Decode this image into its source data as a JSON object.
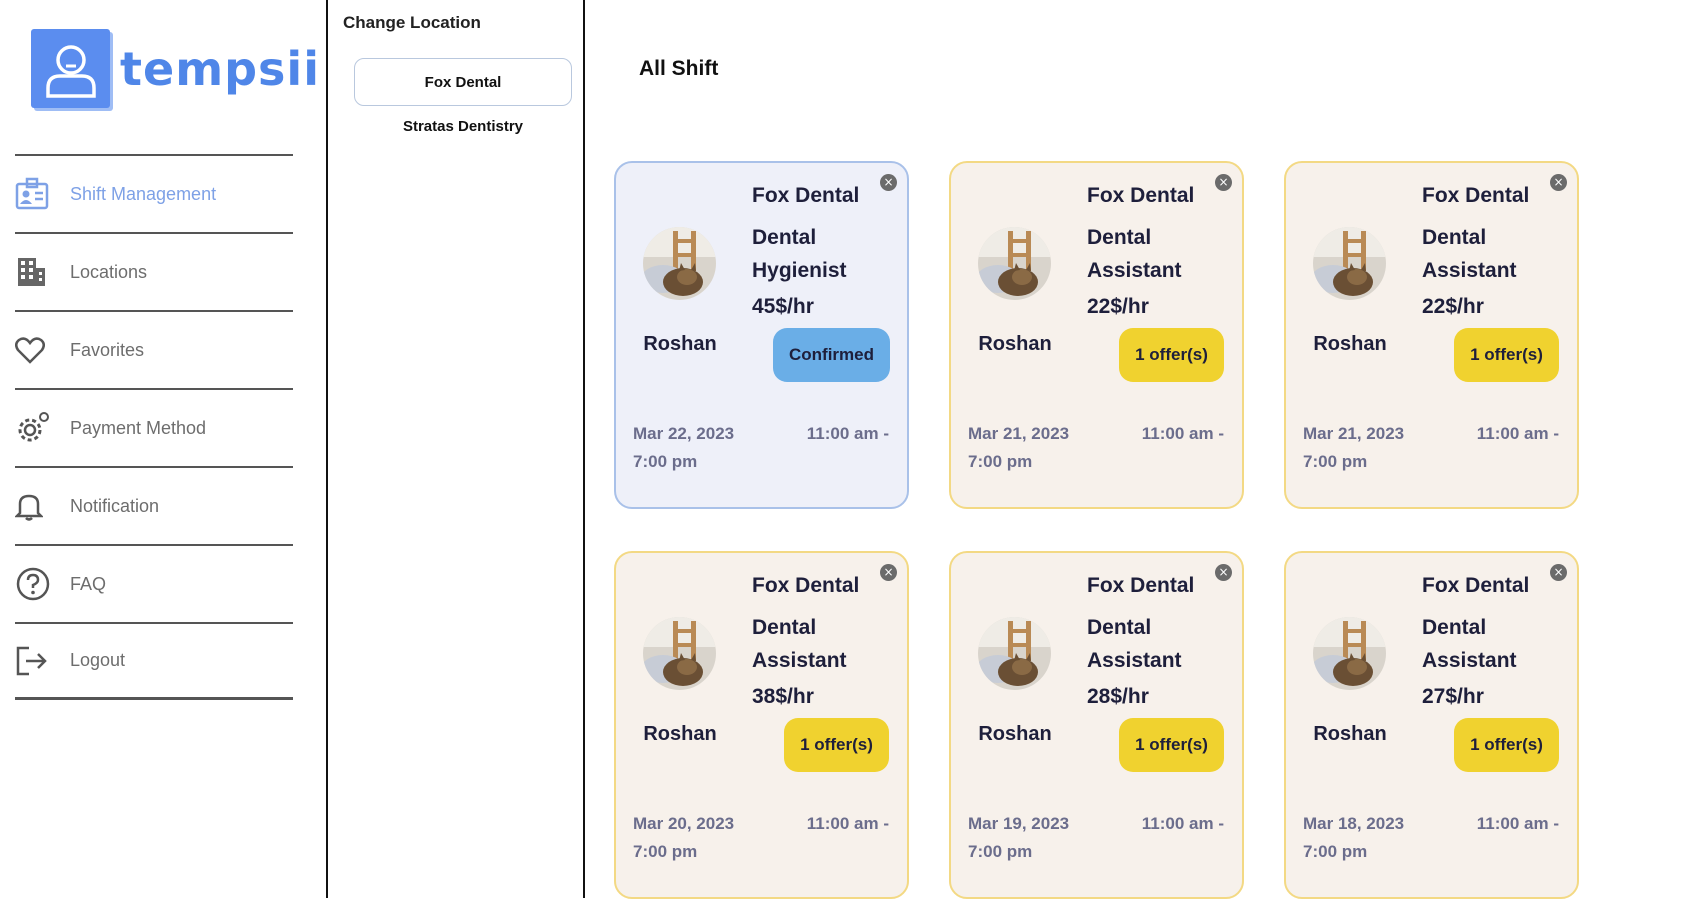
{
  "brand": {
    "name": "tempsii"
  },
  "sidebar": {
    "items": [
      {
        "label": "Shift Management",
        "icon": "badge-icon",
        "active": true
      },
      {
        "label": "Locations",
        "icon": "building-icon",
        "active": false
      },
      {
        "label": "Favorites",
        "icon": "heart-icon",
        "active": false
      },
      {
        "label": "Payment Method",
        "icon": "gear-icon",
        "active": false
      },
      {
        "label": "Notification",
        "icon": "bell-icon",
        "active": false
      },
      {
        "label": "FAQ",
        "icon": "question-icon",
        "active": false
      },
      {
        "label": "Logout",
        "icon": "logout-icon",
        "active": false
      }
    ]
  },
  "locations": {
    "title": "Change Location",
    "selected": "Fox Dental",
    "other": "Stratas Dentistry"
  },
  "main": {
    "title": "All Shift",
    "cards": [
      {
        "clinic": "Fox Dental",
        "role": "Dental Hygienist",
        "rate": "45$/hr",
        "worker": "Roshan",
        "status": "Confirmed",
        "status_type": "confirmed",
        "date": "Mar 22, 2023",
        "time_start": "11:00 am -",
        "time_end": "7:00 pm"
      },
      {
        "clinic": "Fox Dental",
        "role": "Dental Assistant",
        "rate": "22$/hr",
        "worker": "Roshan",
        "status": "1 offer(s)",
        "status_type": "offer",
        "date": "Mar 21, 2023",
        "time_start": "11:00 am -",
        "time_end": "7:00 pm"
      },
      {
        "clinic": "Fox Dental",
        "role": "Dental Assistant",
        "rate": "22$/hr",
        "worker": "Roshan",
        "status": "1 offer(s)",
        "status_type": "offer",
        "date": "Mar 21, 2023",
        "time_start": "11:00 am -",
        "time_end": "7:00 pm"
      },
      {
        "clinic": "Fox Dental",
        "role": "Dental Assistant",
        "rate": "38$/hr",
        "worker": "Roshan",
        "status": "1 offer(s)",
        "status_type": "offer",
        "date": "Mar 20, 2023",
        "time_start": "11:00 am -",
        "time_end": "7:00 pm"
      },
      {
        "clinic": "Fox Dental",
        "role": "Dental Assistant",
        "rate": "28$/hr",
        "worker": "Roshan",
        "status": "1 offer(s)",
        "status_type": "offer",
        "date": "Mar 19, 2023",
        "time_start": "11:00 am -",
        "time_end": "7:00 pm"
      },
      {
        "clinic": "Fox Dental",
        "role": "Dental Assistant",
        "rate": "27$/hr",
        "worker": "Roshan",
        "status": "1 offer(s)",
        "status_type": "offer",
        "date": "Mar 18, 2023",
        "time_start": "11:00 am -",
        "time_end": "7:00 pm"
      }
    ]
  },
  "colors": {
    "brand": "#4f86e8",
    "offer_badge": "#f0d22f",
    "confirmed_badge": "#6aaee7",
    "card_bg": "#f7f1eb",
    "card_confirmed_bg": "#eef0f9"
  }
}
